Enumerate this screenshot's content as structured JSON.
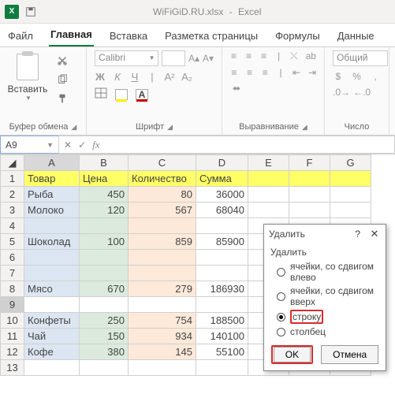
{
  "title": {
    "filename": "WiFiGiD.RU.xlsx",
    "appname": "Excel"
  },
  "tabs": [
    "Файл",
    "Главная",
    "Вставка",
    "Разметка страницы",
    "Формулы",
    "Данные"
  ],
  "active_tab": 1,
  "ribbon": {
    "clipboard": {
      "paste_label": "Вставить",
      "group": "Буфер обмена"
    },
    "font": {
      "name": "Calibri",
      "group": "Шрифт",
      "bold": "Ж",
      "italic": "К",
      "underline": "Ч"
    },
    "alignment": {
      "group": "Выравнивание"
    },
    "number": {
      "format": "Общий",
      "group": "Число"
    }
  },
  "namebox": "A9",
  "formula": "",
  "grid": {
    "cols": [
      "A",
      "B",
      "C",
      "D",
      "E",
      "F",
      "G"
    ],
    "rows": [
      "1",
      "2",
      "3",
      "4",
      "5",
      "6",
      "7",
      "8",
      "9",
      "10",
      "11",
      "12",
      "13"
    ],
    "active_row": 9,
    "active_col": 0,
    "headers": [
      "Товар",
      "Цена",
      "Количество",
      "Сумма"
    ],
    "data": [
      {
        "a": "Рыба",
        "b": "450",
        "c": "80",
        "d": "36000"
      },
      {
        "a": "Молоко",
        "b": "120",
        "c": "567",
        "d": "68040"
      },
      {
        "a": "",
        "b": "",
        "c": "",
        "d": ""
      },
      {
        "a": "Шоколад",
        "b": "100",
        "c": "859",
        "d": "85900"
      },
      {
        "a": "",
        "b": "",
        "c": "",
        "d": ""
      },
      {
        "a": "",
        "b": "",
        "c": "",
        "d": ""
      },
      {
        "a": "Мясо",
        "b": "670",
        "c": "279",
        "d": "186930"
      },
      {
        "a": "",
        "b": "",
        "c": "",
        "d": ""
      },
      {
        "a": "Конфеты",
        "b": "250",
        "c": "754",
        "d": "188500"
      },
      {
        "a": "Чай",
        "b": "150",
        "c": "934",
        "d": "140100"
      },
      {
        "a": "Кофе",
        "b": "380",
        "c": "145",
        "d": "55100"
      }
    ]
  },
  "dialog": {
    "title": "Удалить",
    "help": "?",
    "group_label": "Удалить",
    "options": [
      "ячейки, со сдвигом влево",
      "ячейки, со сдвигом вверх",
      "строку",
      "столбец"
    ],
    "selected": 2,
    "ok": "OK",
    "cancel": "Отмена"
  }
}
